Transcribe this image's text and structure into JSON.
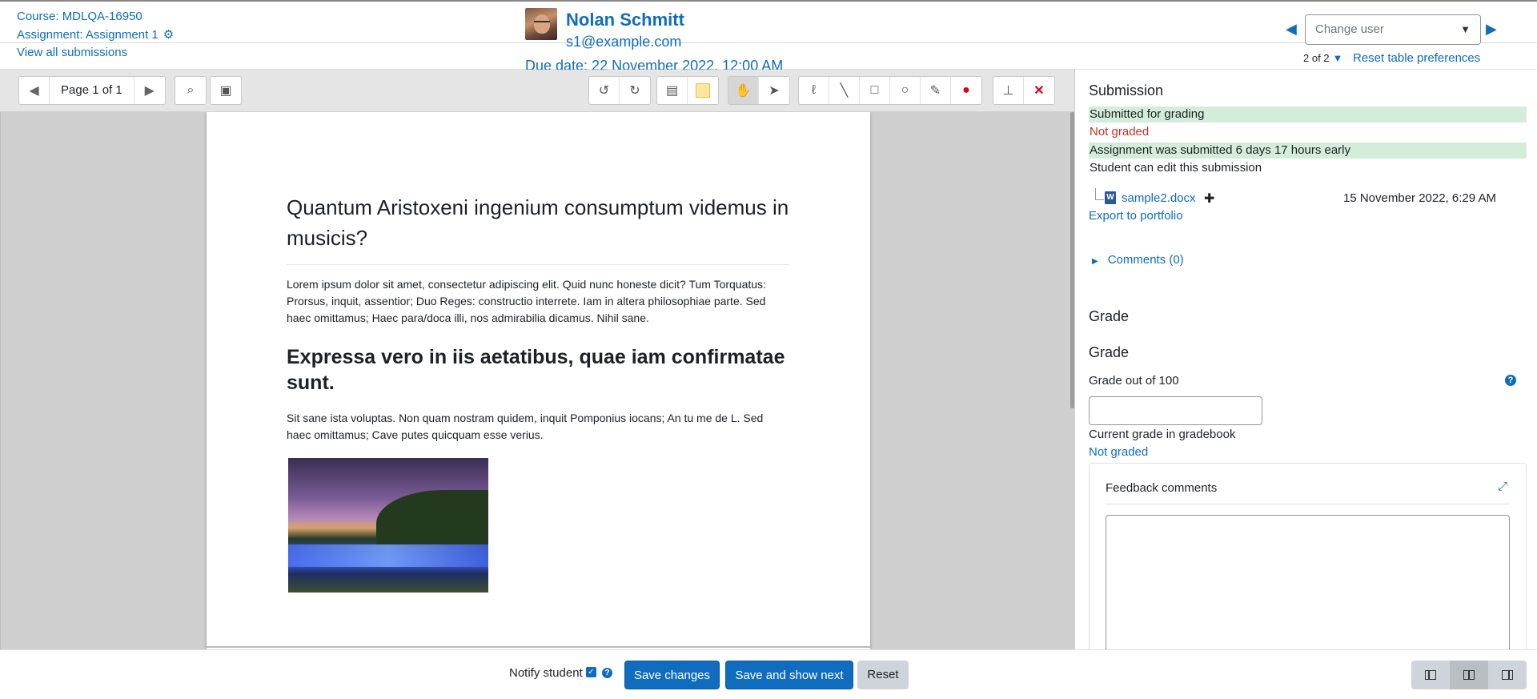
{
  "header": {
    "course_label": "Course: MDLQA-16950",
    "assignment_label": "Assignment: Assignment 1",
    "view_all": "View all submissions",
    "user_name": "Nolan Schmitt",
    "user_email": "s1@example.com",
    "due_date": "Due date: 22 November 2022, 12:00 AM",
    "change_user_placeholder": "Change user",
    "pager_count": "2 of 2",
    "reset_prefs": "Reset table preferences"
  },
  "toolbar": {
    "page_label": "Page 1 of 1"
  },
  "document": {
    "heading": "Quantum Aristoxeni ingenium consumptum videmus in musicis?",
    "para1": "Lorem ipsum dolor sit amet, consectetur adipiscing elit. Quid nunc honeste dicit? Tum Torquatus: Prorsus, inquit, assentior; Duo Reges: constructio interrete. Iam in altera philosophiae parte. Sed haec omittamus; Haec para/doca illi, nos admirabilia dicamus. Nihil sane.",
    "heading2": "Expressa vero in iis aetatibus, quae iam confirmatae sunt.",
    "para2": "Sit sane ista voluptas. Non quam nostram quidem, inquit Pomponius iocans; An tu me de L. Sed haec omittamus; Cave putes quicquam esse verius."
  },
  "panel": {
    "title": "Submission",
    "status_submitted": "Submitted for grading",
    "status_grade": "Not graded",
    "status_early": "Assignment was submitted 6 days 17 hours early",
    "status_edit": "Student can edit this submission",
    "file_name": "sample2.docx",
    "file_date": "15 November 2022, 6:29 AM",
    "export": "Export to portfolio",
    "comments": "Comments (0)",
    "grade_heading1": "Grade",
    "grade_heading2": "Grade",
    "grade_label": "Grade out of 100",
    "current_grade_label": "Current grade in gradebook",
    "current_grade_value": "Not graded",
    "feedback_title": "Feedback comments"
  },
  "footer": {
    "notify_label": "Notify student",
    "save": "Save changes",
    "save_next": "Save and show next",
    "reset": "Reset"
  },
  "colors": {
    "accent": "#0f6cbf",
    "success_bg": "#d4edda",
    "danger": "#ca3120"
  }
}
